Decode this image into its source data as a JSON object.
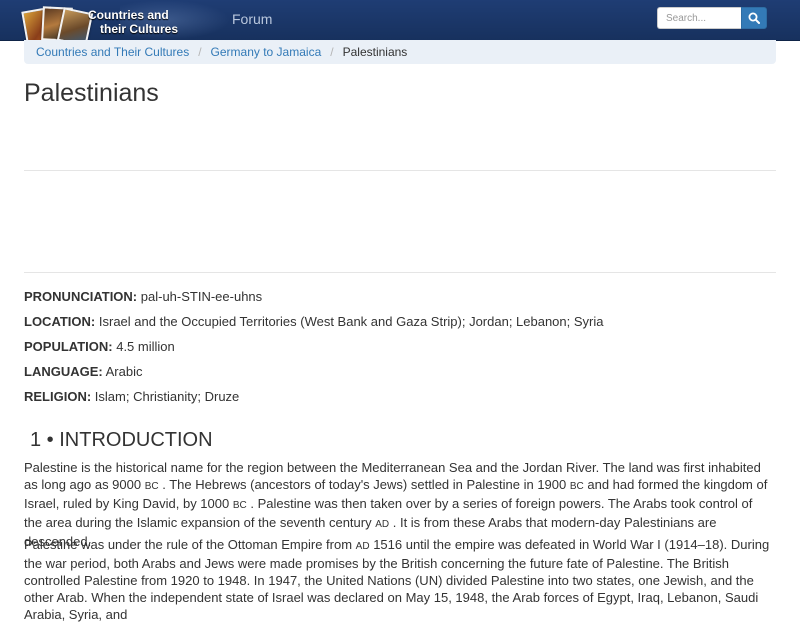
{
  "header": {
    "logo_line1": "Countries and",
    "logo_line2": "their Cultures",
    "nav_forum": "Forum",
    "search_placeholder": "Search...",
    "search_icon": "search-icon"
  },
  "breadcrumb": [
    "Countries and Their Cultures",
    "Germany to Jamaica",
    "Palestinians"
  ],
  "page_title": "Palestinians",
  "facts": [
    {
      "label": "PRONUNCIATION:",
      "value": "pal-uh-STIN-ee-uhns"
    },
    {
      "label": "LOCATION:",
      "value": "Israel and the Occupied Territories (West Bank and Gaza Strip); Jordan; Lebanon; Syria"
    },
    {
      "label": "POPULATION:",
      "value": "4.5 million"
    },
    {
      "label": "LANGUAGE:",
      "value": "Arabic"
    },
    {
      "label": "RELIGION:",
      "value": "Islam; Christianity; Druze"
    }
  ],
  "section_heading": "1 • INTRODUCTION",
  "paragraph1": {
    "t1": "Palestine is the historical name for the region between the Mediterranean Sea and the Jordan River. The land was first inhabited as long ago as 9000 ",
    "bc": "BC",
    "t2": " . The Hebrews (ancestors of today's Jews) settled in Palestine in 1900 ",
    "t3": " and had formed the kingdom of Israel, ruled by King David, by 1000 ",
    "t4": " . Palestine was then taken over by a series of foreign powers. The Arabs took control of the area during the Islamic expansion of the seventh century ",
    "ad": "AD",
    "t5": " . It is from these Arabs that modern-day Palestinians are descended."
  },
  "paragraph2": {
    "t1": "Palestine was under the rule of the Ottoman Empire from ",
    "ad": "AD",
    "t2": " 1516 until the empire was defeated in World War I (1914–18). During the war period, both Arabs and Jews were made promises by the British concerning the future fate of Palestine. The British controlled Palestine from 1920 to 1948. In 1947, the United Nations (UN) divided Palestine into two states, one Jewish, and the other Arab. When the independent state of Israel was declared on May 15, 1948, the Arab forces of Egypt, Iraq, Lebanon, Saudi Arabia, Syria, and"
  },
  "colors": {
    "navbar": "#1f3d74",
    "link": "#337ab7",
    "breadcrumb_bg": "#eaf0f7",
    "search_button": "#337ab7"
  }
}
